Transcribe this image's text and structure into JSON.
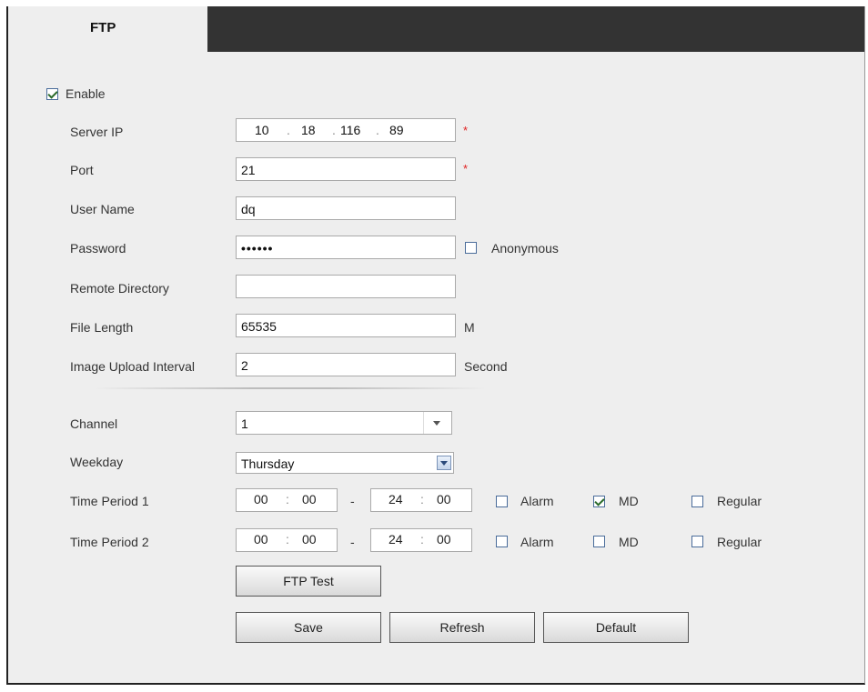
{
  "tab": {
    "label": "FTP"
  },
  "enable": {
    "label": "Enable",
    "checked": true
  },
  "server_ip": {
    "label": "Server IP",
    "octets": [
      "10",
      "18",
      "116",
      "89"
    ],
    "required": "*"
  },
  "port": {
    "label": "Port",
    "value": "21",
    "required": "*"
  },
  "user_name": {
    "label": "User Name",
    "value": "dq"
  },
  "password": {
    "label": "Password",
    "value": "••••••",
    "anonymous_label": "Anonymous",
    "anonymous_checked": false
  },
  "remote_directory": {
    "label": "Remote Directory",
    "value": ""
  },
  "file_length": {
    "label": "File Length",
    "value": "65535",
    "unit": "M"
  },
  "upload_interval": {
    "label": "Image Upload Interval",
    "value": "2",
    "unit": "Second"
  },
  "channel": {
    "label": "Channel",
    "value": "1"
  },
  "weekday": {
    "label": "Weekday",
    "value": "Thursday"
  },
  "periods": [
    {
      "label": "Time Period 1",
      "start_h": "00",
      "start_m": "00",
      "end_h": "24",
      "end_m": "00",
      "alarm": false,
      "md": true,
      "regular": false
    },
    {
      "label": "Time Period 2",
      "start_h": "00",
      "start_m": "00",
      "end_h": "24",
      "end_m": "00",
      "alarm": false,
      "md": false,
      "regular": false
    }
  ],
  "checkbox_labels": {
    "alarm": "Alarm",
    "md": "MD",
    "regular": "Regular"
  },
  "buttons": {
    "ftp_test": "FTP Test",
    "save": "Save",
    "refresh": "Refresh",
    "default": "Default"
  }
}
